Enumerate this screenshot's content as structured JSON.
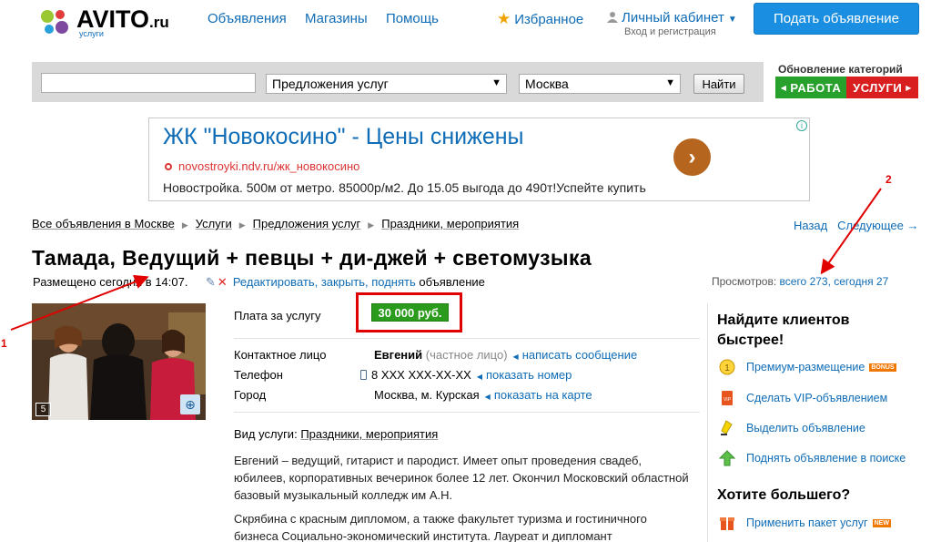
{
  "header": {
    "logo_text": "AVITO",
    "logo_domain": ".ru",
    "logo_sub": "услуги",
    "nav": [
      "Объявления",
      "Магазины",
      "Помощь"
    ],
    "favorites": "Избранное",
    "cabinet": "Личный кабинет",
    "cabinet_sub": "Вход и регистрация",
    "post_button": "Подать объявление"
  },
  "search": {
    "query_value": "",
    "category": "Предложения услуг",
    "region": "Москва",
    "button": "Найти"
  },
  "update": {
    "title": "Обновление категорий",
    "work": "РАБОТА",
    "services": "УСЛУГИ"
  },
  "ad": {
    "title": "ЖК \"Новокосино\" - Цены снижены",
    "url": "novostroyki.ndv.ru/жк_новокосино",
    "text": "Новостройка. 500м от метро. 85000р/м2. До 15.05 выгода до 490т!Успейте купить"
  },
  "breadcrumb": [
    "Все объявления в Москве",
    "Услуги",
    "Предложения услуг",
    "Праздники, мероприятия"
  ],
  "prevnext": {
    "prev": "Назад",
    "next": "Следующее →"
  },
  "listing": {
    "title": "Тамада, Ведущий + певцы + ди-джей + светомузыка",
    "posted": "Размещено сегодня в 14:07.",
    "edit_link": "Редактировать, закрыть, поднять",
    "edit_suffix": "объявление",
    "views_label": "Просмотров:",
    "views_value": "всего 273, сегодня 27",
    "photo_count": "5",
    "price_label": "Плата за услугу",
    "price": "30 000 руб.",
    "contact_label": "Контактное лицо",
    "contact_name": "Евгений",
    "contact_type": "(частное лицо)",
    "contact_link": "написать сообщение",
    "phone_label": "Телефон",
    "phone_value": "8 XXX XXX-XX-XX",
    "phone_link": "показать номер",
    "city_label": "Город",
    "city_value": "Москва, м. Курская",
    "city_link": "показать на карте",
    "service_type_label": "Вид услуги:",
    "service_type_value": "Праздники, мероприятия",
    "desc_1": "Евгений – ведущий, гитарист и пародист. Имеет опыт проведения свадеб, юбилеев, корпоративных вечеринок более 12 лет. Окончил Московский областной базовый музыкальный колледж им А.Н.",
    "desc_2": "Скрябина с красным дипломом, а также факультет туризма и гостиничного бизнеса Социально-экономический института. Лауреат и дипломант"
  },
  "sidebar": {
    "heading1": "Найдите клиентов быстрее!",
    "items": [
      {
        "label": "Премиум-размещение",
        "badge": "BONUS"
      },
      {
        "label": "Сделать VIP-объявлением"
      },
      {
        "label": "Выделить объявление"
      },
      {
        "label": "Поднять объявление в поиске"
      }
    ],
    "heading2": "Хотите большего?",
    "package": {
      "label": "Применить пакет услуг",
      "badge": "NEW"
    }
  },
  "annotations": {
    "one": "1",
    "two": "2"
  },
  "colors": {
    "brand_blue": "#1a8ee0",
    "price_green": "#2a9b1c",
    "annotation_red": "#e00000",
    "work_green": "#27a02c",
    "services_red": "#d81e1e"
  }
}
